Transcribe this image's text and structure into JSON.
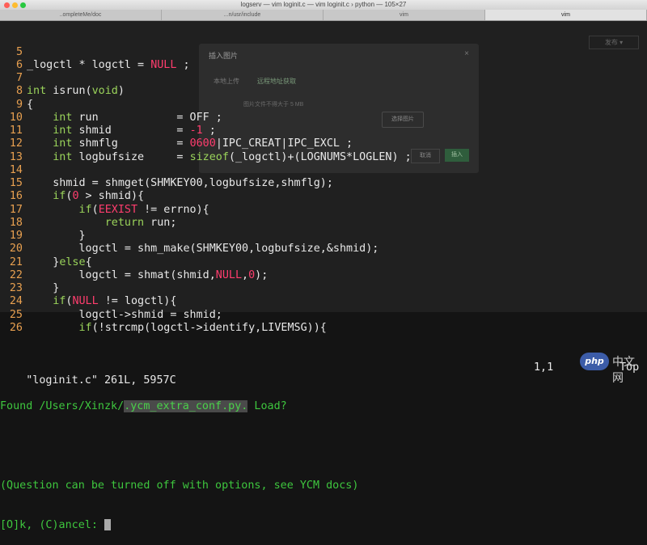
{
  "window": {
    "title": "logserv — vim loginit.c — vim loginit.c › python — 105×27",
    "tabs": [
      {
        "label": "..ompleteMe/doc"
      },
      {
        "label": "...n/usr/include"
      },
      {
        "label": "vim"
      },
      {
        "label": "vim",
        "active": true
      }
    ]
  },
  "editor": {
    "lines": [
      {
        "n": "5",
        "segs": []
      },
      {
        "n": "6",
        "segs": [
          [
            "code",
            "_logctl * logctl = "
          ],
          [
            "cn",
            "NULL"
          ],
          [
            "code",
            " ;"
          ]
        ]
      },
      {
        "n": "7",
        "segs": []
      },
      {
        "n": "8",
        "segs": [
          [
            "ty",
            "int"
          ],
          [
            "code",
            " isrun("
          ],
          [
            "ty",
            "void"
          ],
          [
            "code",
            ")"
          ]
        ]
      },
      {
        "n": "9",
        "segs": [
          [
            "code",
            "{"
          ]
        ]
      },
      {
        "n": "10",
        "segs": [
          [
            "code",
            "    "
          ],
          [
            "ty",
            "int"
          ],
          [
            "code",
            " run            = OFF ;"
          ]
        ]
      },
      {
        "n": "11",
        "segs": [
          [
            "code",
            "    "
          ],
          [
            "ty",
            "int"
          ],
          [
            "code",
            " shmid          = "
          ],
          [
            "cn",
            "-1"
          ],
          [
            "code",
            " ;"
          ]
        ]
      },
      {
        "n": "12",
        "segs": [
          [
            "code",
            "    "
          ],
          [
            "ty",
            "int"
          ],
          [
            "code",
            " shmflg         = "
          ],
          [
            "cn",
            "0600"
          ],
          [
            "code",
            "|IPC_CREAT|IPC_EXCL ;"
          ]
        ]
      },
      {
        "n": "13",
        "segs": [
          [
            "code",
            "    "
          ],
          [
            "ty",
            "int"
          ],
          [
            "code",
            " logbufsize     = "
          ],
          [
            "kw",
            "sizeof"
          ],
          [
            "code",
            "(_logctl)+(LOGNUMS*LOGLEN) ;"
          ]
        ]
      },
      {
        "n": "14",
        "segs": []
      },
      {
        "n": "15",
        "segs": [
          [
            "code",
            "    shmid = shmget(SHMKEY00,logbufsize,shmflg);"
          ]
        ]
      },
      {
        "n": "16",
        "segs": [
          [
            "code",
            "    "
          ],
          [
            "kw",
            "if"
          ],
          [
            "code",
            "("
          ],
          [
            "cn",
            "0"
          ],
          [
            "code",
            " > shmid){"
          ]
        ]
      },
      {
        "n": "17",
        "segs": [
          [
            "code",
            "        "
          ],
          [
            "kw",
            "if"
          ],
          [
            "code",
            "("
          ],
          [
            "cn",
            "EEXIST"
          ],
          [
            "code",
            " != errno){"
          ]
        ]
      },
      {
        "n": "18",
        "segs": [
          [
            "code",
            "            "
          ],
          [
            "kw",
            "return"
          ],
          [
            "code",
            " run;"
          ]
        ]
      },
      {
        "n": "19",
        "segs": [
          [
            "code",
            "        }"
          ]
        ]
      },
      {
        "n": "20",
        "segs": [
          [
            "code",
            "        logctl = shm_make(SHMKEY00,logbufsize,&shmid);"
          ]
        ]
      },
      {
        "n": "21",
        "segs": [
          [
            "code",
            "    }"
          ],
          [
            "kw",
            "else"
          ],
          [
            "code",
            "{"
          ]
        ]
      },
      {
        "n": "22",
        "segs": [
          [
            "code",
            "        logctl = shmat(shmid,"
          ],
          [
            "cn",
            "NULL"
          ],
          [
            "code",
            ","
          ],
          [
            "cn",
            "0"
          ],
          [
            "code",
            ");"
          ]
        ]
      },
      {
        "n": "23",
        "segs": [
          [
            "code",
            "    }"
          ]
        ]
      },
      {
        "n": "24",
        "segs": [
          [
            "code",
            "    "
          ],
          [
            "kw",
            "if"
          ],
          [
            "code",
            "("
          ],
          [
            "cn",
            "NULL"
          ],
          [
            "code",
            " != logctl){"
          ]
        ]
      },
      {
        "n": "25",
        "segs": [
          [
            "code",
            "        logctl->shmid = shmid;"
          ]
        ]
      },
      {
        "n": "26",
        "segs": [
          [
            "code",
            "        "
          ],
          [
            "kw",
            "if"
          ],
          [
            "code",
            "(!strcmp(logctl->identify,LIVEMSG)){"
          ]
        ]
      }
    ],
    "status": {
      "file": "\"loginit.c\" 261L, 5957C",
      "position": "1,1",
      "scroll": "Top"
    },
    "messages": {
      "found_prefix": "Found /Users/Xinzk/",
      "found_file": ".ycm_extra_conf.py.",
      "found_suffix": " Load?",
      "question": "(Question can be turned off with options, see YCM docs)",
      "prompt": "[O]k, (C)ancel: "
    }
  },
  "background_dialog": {
    "title": "插入图片",
    "close": "×",
    "tab_local": "本地上传",
    "tab_url": "远程地址获取",
    "hint": "图片文件不得大于 5 MB",
    "choose": "选择图片",
    "cancel": "取消",
    "insert": "插入",
    "right_button": "发布 ▾"
  },
  "watermark": {
    "badge": "php",
    "text": "中文网"
  },
  "colors": {
    "background": "#141414",
    "line_number": "#e8a050",
    "keyword": "#9ad35a",
    "constant": "#ff3d6e",
    "prompt_green": "#3ec63e"
  }
}
